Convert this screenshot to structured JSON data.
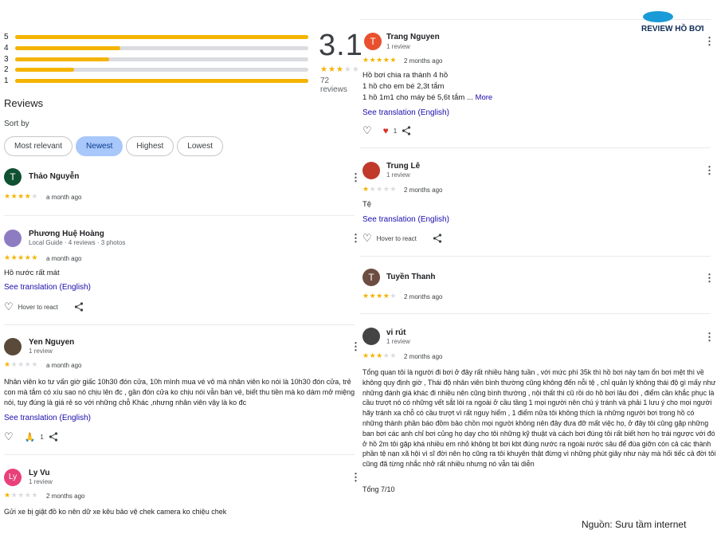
{
  "histogram": [
    {
      "label": "5",
      "fill": 1.0
    },
    {
      "label": "4",
      "fill": 0.36
    },
    {
      "label": "3",
      "fill": 0.32
    },
    {
      "label": "2",
      "fill": 0.2
    },
    {
      "label": "1",
      "fill": 1.0
    }
  ],
  "summary": {
    "rating": "3.1",
    "stars": 3,
    "count": "72 reviews"
  },
  "reviews_title": "Reviews",
  "sort": {
    "label": "Sort by",
    "options": [
      "Most relevant",
      "Newest",
      "Highest",
      "Lowest"
    ],
    "selected": "Newest"
  },
  "common": {
    "hover_react": "Hover to react",
    "see_translation": "See translation (English)",
    "more": "More"
  },
  "left_reviews": [
    {
      "name": "Thảo Nguyễn",
      "initial": "T",
      "avatar_color": "#0f5132",
      "meta": "",
      "stars": 4,
      "date": "a month ago",
      "text": ""
    },
    {
      "name": "Phương Huệ Hoàng",
      "initial": "P",
      "avatar_color": "#8e7cc3",
      "meta": "Local Guide · 4 reviews · 3 photos",
      "stars": 5,
      "date": "a month ago",
      "text": "Hồ nước rất mát"
    },
    {
      "name": "Yen Nguyen",
      "initial": "Y",
      "avatar_color": "#5a4a3a",
      "meta": "1 review",
      "stars": 1,
      "date": "a month ago",
      "text": "Nhân viên ko tư vấn giờ giấc 10h30 đón cửa, 10h mình mua vé vô mà nhân viên ko nói là 10h30 đón cửa, trẻ con mà tắm có xíu sao nó chịu lên đc , gần đón cửa ko chịu nói vẫn bán vé, biết thu tiền mà ko dám mở miệng nói, tuy đúng là giá rẻ so với những chỗ Khác ,nhưng nhân viên vậy là ko đc",
      "reactions": {
        "count": "1"
      }
    },
    {
      "name": "Ly Vu",
      "initial": "Ly",
      "avatar_color": "#e8407a",
      "meta": "1 review",
      "stars": 1,
      "date": "2 months ago",
      "text": "Gửi xe bị giật đồ ko nên dữ xe kêu bảo vệ chek camera ko chiệu chek"
    }
  ],
  "right_reviews": [
    {
      "name": "Trang Nguyen",
      "initial": "T",
      "avatar_color": "#e8502e",
      "meta": "1 review",
      "stars": 5,
      "date": "2 months ago",
      "lines": [
        "Hồ bơi chia ra thành 4 hồ",
        "1 hồ cho em bé 2,3t tắm",
        "1 hồ 1m1 cho máy bé 5,6t tắm ..."
      ],
      "reactions": {
        "count": "1"
      }
    },
    {
      "name": "Trung Lê",
      "initial": "T",
      "avatar_color": "#c0392b",
      "meta": "1 review",
      "stars": 1,
      "date": "2 months ago",
      "text": "Tệ"
    },
    {
      "name": "Tuyền Thanh",
      "initial": "T",
      "avatar_color": "#6d4c41",
      "meta": "",
      "stars": 4,
      "date": "2 months ago",
      "text": ""
    },
    {
      "name": "vi rút",
      "initial": "v",
      "avatar_color": "#444444",
      "meta": "1 review",
      "stars": 3,
      "date": "2 months ago",
      "text": "Tổng quan tôi là người đi bơi ở đây rất nhiều hàng tuần , với mức phí 35k thì hồ bơi này tạm ổn bơi mệt thì về không quy định giờ , Thái độ nhân viên bình thường cũng không đến nỗi tệ , chỉ quản lý không thái độ gì mấy như những đánh giá khác đi nhiều nên cũng bình thường , nội thất thì cũ rồi do hồ bơi lâu đời , điểm cần khắc phục là cầu trượt nó có những vết sắt lòi ra ngoài ở cầu tầng 1 mọi người nên chú ý tránh và phải 1 lưu ý cho mọi người hãy tránh xa chỗ có cầu trượt vì rất nguy hiểm , 1 điểm nữa tôi không thích là những người bơi trong hồ có những thành phần báo đồm bảo chồn mọi người không nên đây đưa đỡ mất việc họ, ở đây tôi cũng gặp những ban bơi các anh chỉ bơi củng họ dạy cho tôi những kỹ thuật và cách bơi đúng tôi rất biết hơn họ trái ngược với đó ở hồ 2m tôi gặp khá nhiều em nhỏ không bt bơi kbt đúng nước ra ngoài nước sâu để đùa giỡn còn cả các thành phần tệ nạn xã hội vì sĩ đời nên họ cũng ra tôi khuyên thật đừng vì những phút giây như này mà hối tiếc cả đời tôi cũng đã từng nhắc nhở rất nhiều nhưng nó vẫn tái diễn",
      "footer": "Tổng 7/10"
    }
  ],
  "brand": {
    "logo_text": "REVIEW HỒ BƠI"
  },
  "source": "Nguồn: Sưu tầm internet"
}
